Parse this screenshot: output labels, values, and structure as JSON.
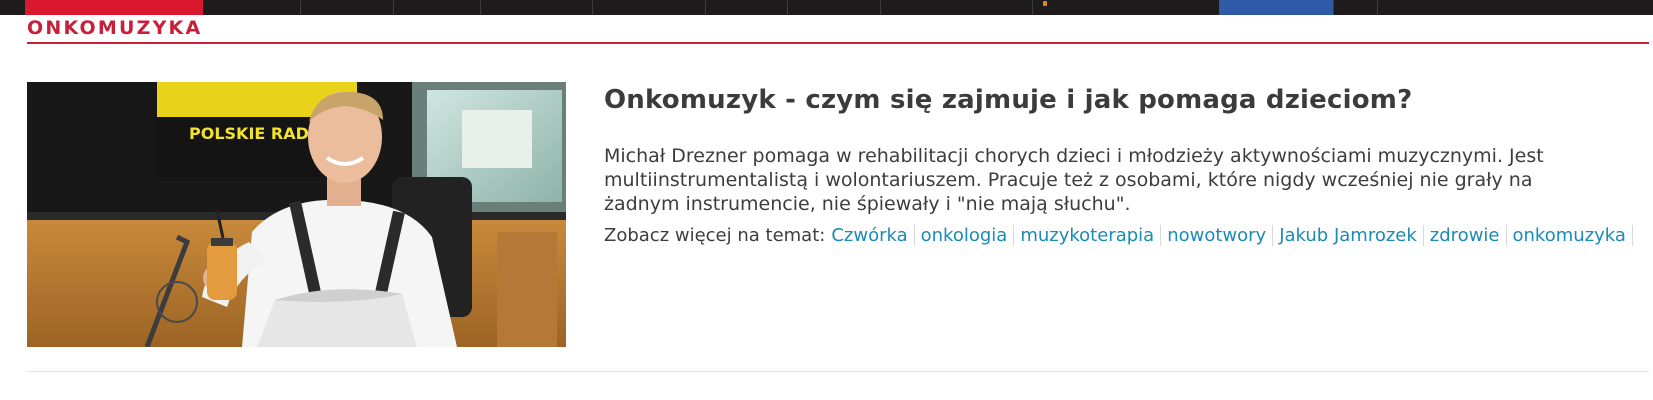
{
  "section": {
    "title": "ONKOMUZYKA"
  },
  "article": {
    "title": "Onkomuzyk - czym się zajmuje i jak pomaga dzieciom?",
    "lead": "Michał Drezner pomaga w rehabilitacji chorych dzieci i młodzieży aktywnościami muzycznymi. Jest multiinstrumentalistą i wolontariuszem. Pracuje też z osobami, które nigdy wcześniej nie grały na żadnym instrumencie, nie śpiewały i \"nie mają słuchu\".",
    "image": {
      "sign_text": "POLSKIE RADIO"
    },
    "tags_prefix": "Zobacz więcej na temat:",
    "tags": [
      "Czwórka",
      "onkologia",
      "muzykoterapia",
      "nowotwory",
      "Jakub Jamrozek",
      "zdrowie",
      "onkomuzyka"
    ]
  },
  "colors": {
    "accent_red": "#c8203a",
    "link_blue": "#1a8ab6",
    "nav_bg": "#1d1b1b"
  }
}
